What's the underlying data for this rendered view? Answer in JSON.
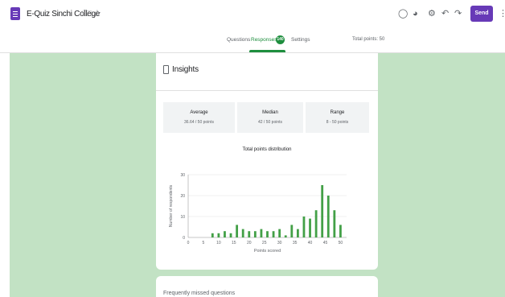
{
  "header": {
    "title": "E-Quiz Sinchi College",
    "send_label": "Send",
    "icons": [
      "folder-icon",
      "star-icon",
      "palette-icon",
      "preview-icon",
      "settings-icon",
      "undo-icon",
      "redo-icon",
      "more-vert-icon"
    ]
  },
  "tabs": {
    "items": [
      "Questions",
      "Responses",
      "Settings"
    ],
    "active": "Responses",
    "responses_count": "140",
    "total_points": "Total points: 50"
  },
  "insights": {
    "title": "Insights",
    "stats": [
      {
        "label": "Average",
        "value": "36.64 / 50 points"
      },
      {
        "label": "Median",
        "value": "42 / 50 points"
      },
      {
        "label": "Range",
        "value": "8 - 50 points"
      }
    ]
  },
  "colors": {
    "accent": "#673ab7",
    "green": "#1e8e3e",
    "bar": "#43a047",
    "canvas": "#c2e2c4"
  },
  "chart_data": {
    "type": "bar",
    "title": "Total points distribution",
    "xlabel": "Points scored",
    "ylabel": "Number of respondents",
    "x": [
      8,
      10,
      12,
      14,
      16,
      18,
      20,
      22,
      24,
      26,
      28,
      30,
      32,
      34,
      36,
      38,
      40,
      42,
      44,
      46,
      48,
      50
    ],
    "values": [
      2,
      2,
      3,
      2,
      6,
      4,
      3,
      3,
      4,
      3,
      3,
      4,
      1,
      6,
      4,
      10,
      9,
      13,
      25,
      20,
      13,
      6
    ],
    "xticks": [
      0,
      5,
      10,
      15,
      20,
      25,
      30,
      35,
      40,
      45,
      50
    ],
    "yticks": [
      0,
      10,
      20,
      30
    ],
    "xlim": [
      0,
      52
    ],
    "ylim": [
      0,
      30
    ],
    "grid": true
  },
  "next_card": {
    "text": "Frequently missed questions"
  }
}
